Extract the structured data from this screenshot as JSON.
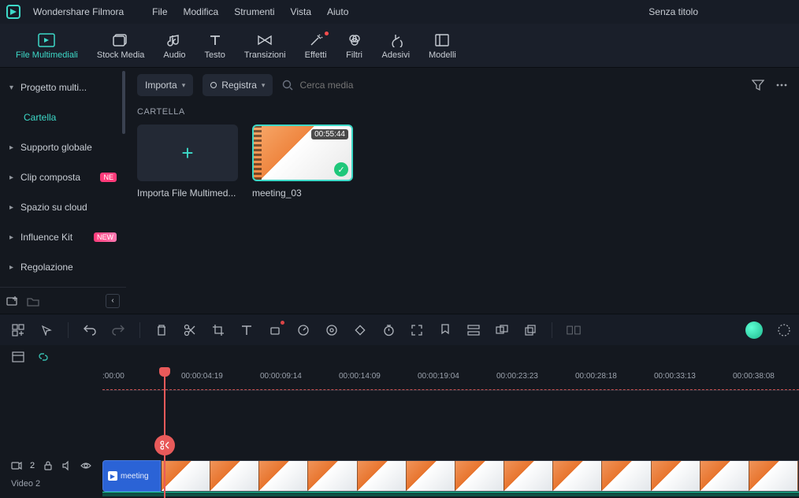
{
  "app": {
    "name": "Wondershare Filmora",
    "project_title": "Senza titolo"
  },
  "menubar": [
    "File",
    "Modifica",
    "Strumenti",
    "Vista",
    "Aiuto"
  ],
  "maintabs": [
    {
      "label": "File Multimediali",
      "icon": "media",
      "active": true
    },
    {
      "label": "Stock Media",
      "icon": "stock"
    },
    {
      "label": "Audio",
      "icon": "audio"
    },
    {
      "label": "Testo",
      "icon": "text"
    },
    {
      "label": "Transizioni",
      "icon": "transitions"
    },
    {
      "label": "Effetti",
      "icon": "effects",
      "dot": true
    },
    {
      "label": "Filtri",
      "icon": "filters"
    },
    {
      "label": "Adesivi",
      "icon": "stickers"
    },
    {
      "label": "Modelli",
      "icon": "templates"
    }
  ],
  "sidebar": {
    "items": [
      {
        "label": "Progetto multi...",
        "expanded": true
      },
      {
        "label": "Cartella",
        "sub": true,
        "active": true
      },
      {
        "label": "Supporto globale"
      },
      {
        "label": "Clip composta",
        "badge": "NE",
        "badgeClass": "new"
      },
      {
        "label": "Spazio su cloud"
      },
      {
        "label": "Influence Kit",
        "badge": "NEW",
        "badgeClass": "new2"
      },
      {
        "label": "Regolazione"
      }
    ]
  },
  "media": {
    "import_label": "Importa",
    "record_label": "Registra",
    "search_placeholder": "Cerca media",
    "heading": "CARTELLA",
    "import_card_label": "Importa File Multimed...",
    "clips": [
      {
        "name": "meeting_03",
        "duration": "00:55:44"
      }
    ]
  },
  "timeline": {
    "ticks": [
      ":00:00",
      "00:00:04:19",
      "00:00:09:14",
      "00:00:14:09",
      "00:00:19:04",
      "00:00:23:23",
      "00:00:28:18",
      "00:00:33:13",
      "00:00:38:08"
    ],
    "track": {
      "name": "Video 2",
      "clip_label": "meeting",
      "count": "2"
    }
  }
}
